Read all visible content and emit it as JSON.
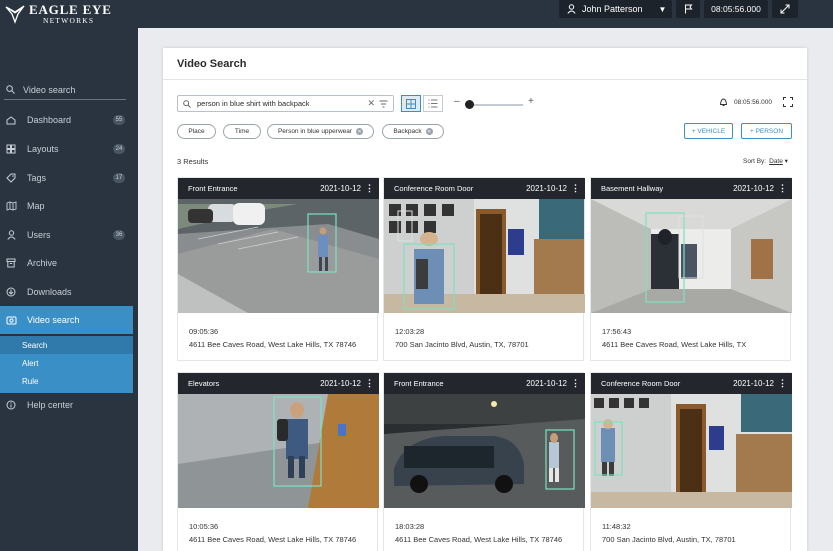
{
  "header": {
    "logo_main": "EAGLE EYE",
    "logo_sub": "NETWORKS",
    "user_name": "John Patterson",
    "clock": "08:05:56.000"
  },
  "sidebar": {
    "search_label": "Video search",
    "items": [
      {
        "label": "Dashboard",
        "count": "55",
        "icon": "dashboard-icon"
      },
      {
        "label": "Layouts",
        "count": "24",
        "icon": "layouts-icon"
      },
      {
        "label": "Tags",
        "count": "17",
        "icon": "tag-icon"
      },
      {
        "label": "Map",
        "count": "",
        "icon": "map-icon"
      },
      {
        "label": "Users",
        "count": "36",
        "icon": "user-icon"
      },
      {
        "label": "Archive",
        "count": "",
        "icon": "archive-icon"
      },
      {
        "label": "Downloads",
        "count": "",
        "icon": "download-icon"
      },
      {
        "label": "Video search",
        "count": "",
        "icon": "video-search-icon"
      }
    ],
    "sub_items": [
      "Search",
      "Alert",
      "Rule"
    ],
    "help": "Help center"
  },
  "main": {
    "title": "Video Search",
    "search_value": "person in blue shirt with backpack",
    "clock_small": "08:05:56.000",
    "filters": [
      {
        "label": "Place",
        "removable": false
      },
      {
        "label": "Time",
        "removable": false
      },
      {
        "label": "Person in blue upperwear",
        "removable": true
      },
      {
        "label": "Backpack",
        "removable": true
      }
    ],
    "add_vehicle": "+ VEHICLE",
    "add_person": "+ PERSON",
    "results_count": "3 Results",
    "sort_label": "Sort By:",
    "sort_value": "Date"
  },
  "tiles": [
    {
      "camera": "Front Entrance",
      "date": "2021-10-12",
      "time": "09:05:36",
      "address": "4611 Bee Caves Road, West Lake Hills, TX 78746"
    },
    {
      "camera": "Conference Room Door",
      "date": "2021-10-12",
      "time": "12:03:28",
      "address": "700 San Jacinto Blvd, Austin, TX, 78701"
    },
    {
      "camera": "Basement Hallway",
      "date": "2021-10-12",
      "time": "17:56:43",
      "address": "4611 Bee Caves Road, West Lake Hills, TX"
    },
    {
      "camera": "Elevators",
      "date": "2021-10-12",
      "time": "10:05:36",
      "address": "4611 Bee Caves Road, West Lake Hills, TX 78746"
    },
    {
      "camera": "Front Entrance",
      "date": "2021-10-12",
      "time": "18:03:28",
      "address": "4611 Bee Caves Road, West Lake Hills, TX 78746"
    },
    {
      "camera": "Conference Room Door",
      "date": "2021-10-12",
      "time": "11:48:32",
      "address": "700 San Jacinto Blvd, Austin, TX, 78701"
    }
  ],
  "colors": {
    "accent": "#3a8fc7",
    "detection_box": "#7fe0c0",
    "sidebar_bg": "#2a3440"
  }
}
